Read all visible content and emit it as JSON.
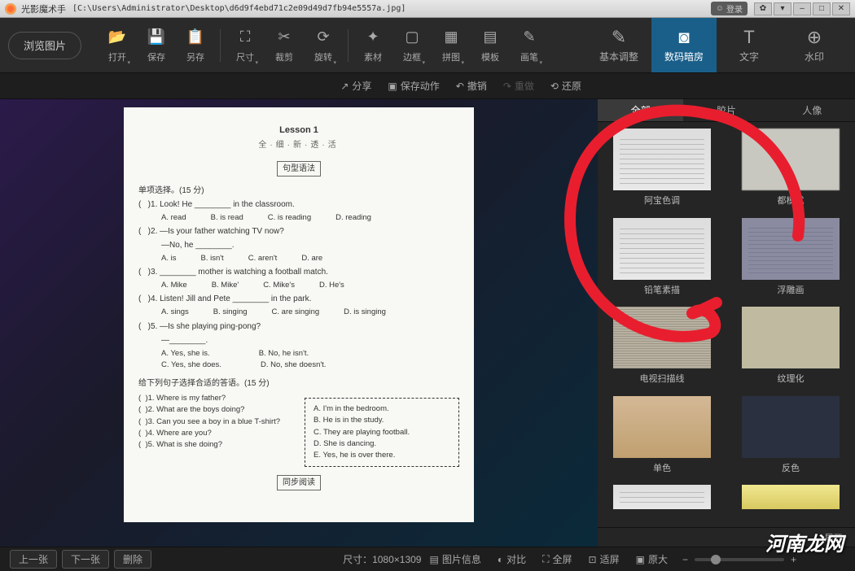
{
  "title_app": "光影魔术手",
  "title_path": "[C:\\Users\\Administrator\\Desktop\\d6d9f4ebd71c2e09d49d7fb94e5557a.jpg]",
  "login": "登录",
  "browse": "浏览图片",
  "tools": {
    "open": "打开",
    "save": "保存",
    "saveas": "另存",
    "size": "尺寸",
    "crop": "裁剪",
    "rotate": "旋转",
    "material": "素材",
    "border": "边框",
    "collage": "拼图",
    "template": "模板",
    "brush": "画笔"
  },
  "right_tabs": {
    "basic": "基本调整",
    "darkroom": "数码暗房",
    "text": "文字",
    "watermark": "水印"
  },
  "actions": {
    "share": "分享",
    "save_action": "保存动作",
    "undo": "撤销",
    "redo": "重做",
    "restore": "还原"
  },
  "filter_tabs": {
    "all": "全部",
    "film": "胶片",
    "portrait": "人像"
  },
  "effects": {
    "e1": "阿宝色调",
    "e2": "都模式",
    "e3": "铅笔素描",
    "e4": "浮雕画",
    "e5": "电视扫描线",
    "e6": "纹理化",
    "e7": "单色",
    "e8": "反色"
  },
  "bottom": {
    "prev": "上一张",
    "next": "下一张",
    "delete": "删除",
    "dims": "尺寸：1080×1309",
    "info": "图片信息",
    "compare": "对比",
    "fullscreen": "全屏",
    "fit": "适屏",
    "original": "原大",
    "expand": "展开"
  },
  "doc": {
    "lesson": "Lesson 1",
    "subtitle": "全·细·新·透·活",
    "grammar": "句型语法",
    "sec1": "单项选择。(15 分)",
    "q1": ")1. Look! He ________ in the classroom.",
    "q1a": "A. read",
    "q1b": "B. is read",
    "q1c": "C. is reading",
    "q1d": "D. reading",
    "q2": ")2. —Is your father watching TV now?",
    "q2n": "—No, he ________.",
    "q2a": "A. is",
    "q2b": "B. isn't",
    "q2c": "C. aren't",
    "q2d": "D. are",
    "q3": ")3. ________ mother is watching a football match.",
    "q3a": "A. Mike",
    "q3b": "B. Mike'",
    "q3c": "C. Mike's",
    "q3d": "D. He's",
    "q4": ")4. Listen! Jill and Pete ________ in the park.",
    "q4a": "A. sings",
    "q4b": "B. singing",
    "q4c": "C. are singing",
    "q4d": "D. is singing",
    "q5": ")5. —Is she playing ping-pong?",
    "q5n": "—________.",
    "q5a": "A. Yes, she is.",
    "q5b": "B. No, he isn't.",
    "q5c": "C. Yes, she does.",
    "q5d": "D. No, she doesn't.",
    "sec2": "给下列句子选择合适的答语。(15 分)",
    "lq1": ")1. Where is my father?",
    "lq2": ")2. What are the boys doing?",
    "lq3": ")3. Can you see a boy in a blue T-shirt?",
    "lq4": ")4. Where are you?",
    "lq5": ")5. What is she doing?",
    "ra": "A. I'm in the bedroom.",
    "rb": "B. He is in the study.",
    "rc": "C. They are playing football.",
    "rd": "D. She is dancing.",
    "re": "E. Yes, he is over there.",
    "reading": "同步阅读"
  },
  "watermark_text": "河南龙网"
}
